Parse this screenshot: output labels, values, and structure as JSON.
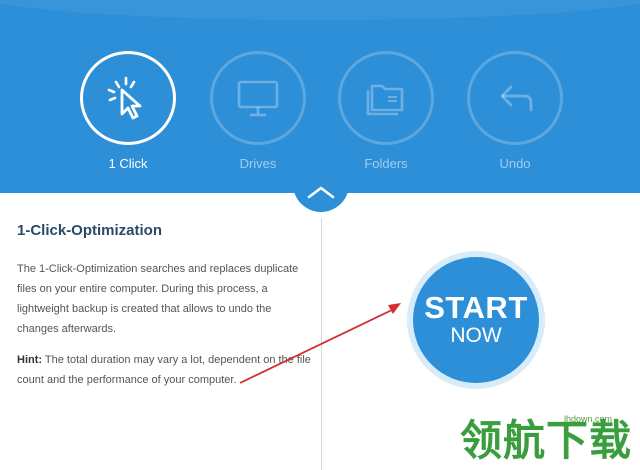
{
  "tabs": [
    {
      "label": "1 Click",
      "icon": "cursor-click-icon",
      "active": true
    },
    {
      "label": "Drives",
      "icon": "monitor-icon",
      "active": false
    },
    {
      "label": "Folders",
      "icon": "folders-icon",
      "active": false
    },
    {
      "label": "Undo",
      "icon": "undo-arrow-icon",
      "active": false
    }
  ],
  "content": {
    "title": "1-Click-Optimization",
    "description": "The 1-Click-Optimization searches and replaces duplicate files on your entire computer. During this process, a lightweight backup is created that allows to undo the changes afterwards.",
    "hint_label": "Hint:",
    "hint_text": " The total duration may vary a lot, dependent on the file count and the performance of your computer."
  },
  "start_button": {
    "line1": "START",
    "line2": "NOW"
  },
  "watermark": {
    "site": "lhdown.com",
    "text": "领航下载"
  },
  "colors": {
    "accent": "#2d8fd8",
    "annotation_arrow": "#d23030",
    "watermark": "#3a9d3e"
  }
}
